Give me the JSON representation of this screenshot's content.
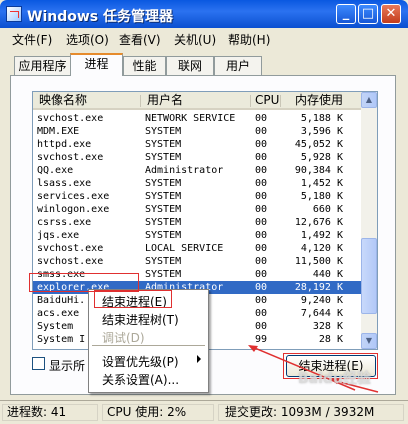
{
  "window": {
    "title": "Windows 任务管理器",
    "controls": {
      "minimize": "_",
      "maximize": "□",
      "close": "✕"
    }
  },
  "menu": [
    "文件(F)",
    "选项(O)",
    "查看(V)",
    "关机(U)",
    "帮助(H)"
  ],
  "tabs": [
    "应用程序",
    "进程",
    "性能",
    "联网",
    "用户"
  ],
  "active_tab": "进程",
  "columns": {
    "name": "映像名称",
    "user": "用户名",
    "cpu": "CPU",
    "mem": "内存使用"
  },
  "processes": [
    {
      "name": "svchost.exe",
      "user": "NETWORK SERVICE",
      "cpu": "00",
      "mem": "5,188 K"
    },
    {
      "name": "MDM.EXE",
      "user": "SYSTEM",
      "cpu": "00",
      "mem": "3,596 K"
    },
    {
      "name": "httpd.exe",
      "user": "SYSTEM",
      "cpu": "00",
      "mem": "45,052 K"
    },
    {
      "name": "svchost.exe",
      "user": "SYSTEM",
      "cpu": "00",
      "mem": "5,928 K"
    },
    {
      "name": "QQ.exe",
      "user": "Administrator",
      "cpu": "00",
      "mem": "90,384 K"
    },
    {
      "name": "lsass.exe",
      "user": "SYSTEM",
      "cpu": "00",
      "mem": "1,452 K"
    },
    {
      "name": "services.exe",
      "user": "SYSTEM",
      "cpu": "00",
      "mem": "5,180 K"
    },
    {
      "name": "winlogon.exe",
      "user": "SYSTEM",
      "cpu": "00",
      "mem": "660 K"
    },
    {
      "name": "csrss.exe",
      "user": "SYSTEM",
      "cpu": "00",
      "mem": "12,676 K"
    },
    {
      "name": "jqs.exe",
      "user": "SYSTEM",
      "cpu": "00",
      "mem": "1,492 K"
    },
    {
      "name": "svchost.exe",
      "user": "LOCAL SERVICE",
      "cpu": "00",
      "mem": "4,120 K"
    },
    {
      "name": "svchost.exe",
      "user": "SYSTEM",
      "cpu": "00",
      "mem": "11,500 K"
    },
    {
      "name": "smss.exe",
      "user": "SYSTEM",
      "cpu": "00",
      "mem": "440 K"
    },
    {
      "name": "explorer.exe",
      "user": "Administrator",
      "cpu": "00",
      "mem": "28,192 K"
    },
    {
      "name": "BaiduHi.",
      "user": "tor",
      "cpu": "00",
      "mem": "9,240 K"
    },
    {
      "name": "acs.exe",
      "user": "",
      "cpu": "00",
      "mem": "7,644 K"
    },
    {
      "name": "System",
      "user": "",
      "cpu": "00",
      "mem": "328 K"
    },
    {
      "name": "System I",
      "user": "",
      "cpu": "99",
      "mem": "28 K"
    }
  ],
  "selected_process": "explorer.exe",
  "show_all_label": "显示所",
  "end_process_button": "结束进程(E)",
  "context_menu": {
    "items": [
      {
        "label": "结束进程(E)",
        "enabled": true
      },
      {
        "label": "结束进程树(T)",
        "enabled": true
      },
      {
        "label": "调试(D)",
        "enabled": false
      },
      {
        "label": "设置优先级(P)",
        "enabled": true,
        "submenu": true
      },
      {
        "label": "关系设置(A)...",
        "enabled": true
      }
    ]
  },
  "status": {
    "processes": "进程数: 41",
    "cpu": "CPU 使用: 2%",
    "commit": "提交更改: 1093M / 3932M"
  },
  "colors": {
    "selection": "#316ac5",
    "annotation": "#e03030",
    "titlebar": "#0a58e0"
  },
  "watermark": "Baidu经验"
}
